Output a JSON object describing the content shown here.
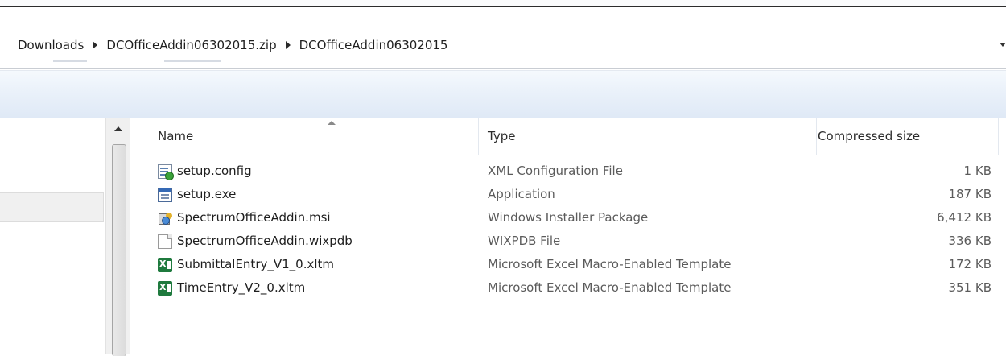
{
  "breadcrumb": {
    "items": [
      "Downloads",
      "DCOfficeAddin06302015.zip",
      "DCOfficeAddin06302015"
    ]
  },
  "columns": {
    "name": "Name",
    "type": "Type",
    "size": "Compressed size"
  },
  "files": [
    {
      "name": "setup.config",
      "type": "XML Configuration File",
      "size": "1 KB",
      "icon": "config-file-icon"
    },
    {
      "name": "setup.exe",
      "type": "Application",
      "size": "187 KB",
      "icon": "application-icon"
    },
    {
      "name": "SpectrumOfficeAddin.msi",
      "type": "Windows Installer Package",
      "size": "6,412 KB",
      "icon": "installer-package-icon"
    },
    {
      "name": "SpectrumOfficeAddin.wixpdb",
      "type": "WIXPDB File",
      "size": "336 KB",
      "icon": "generic-file-icon"
    },
    {
      "name": "SubmittalEntry_V1_0.xltm",
      "type": "Microsoft Excel Macro-Enabled Template",
      "size": "172 KB",
      "icon": "excel-template-icon"
    },
    {
      "name": "TimeEntry_V2_0.xltm",
      "type": "Microsoft Excel Macro-Enabled Template",
      "size": "351 KB",
      "icon": "excel-template-icon"
    }
  ],
  "colors": {
    "toolbar_top": "#f5f9fd",
    "toolbar_bottom": "#dfe9f6",
    "secondary_text": "#5b5b5b"
  }
}
